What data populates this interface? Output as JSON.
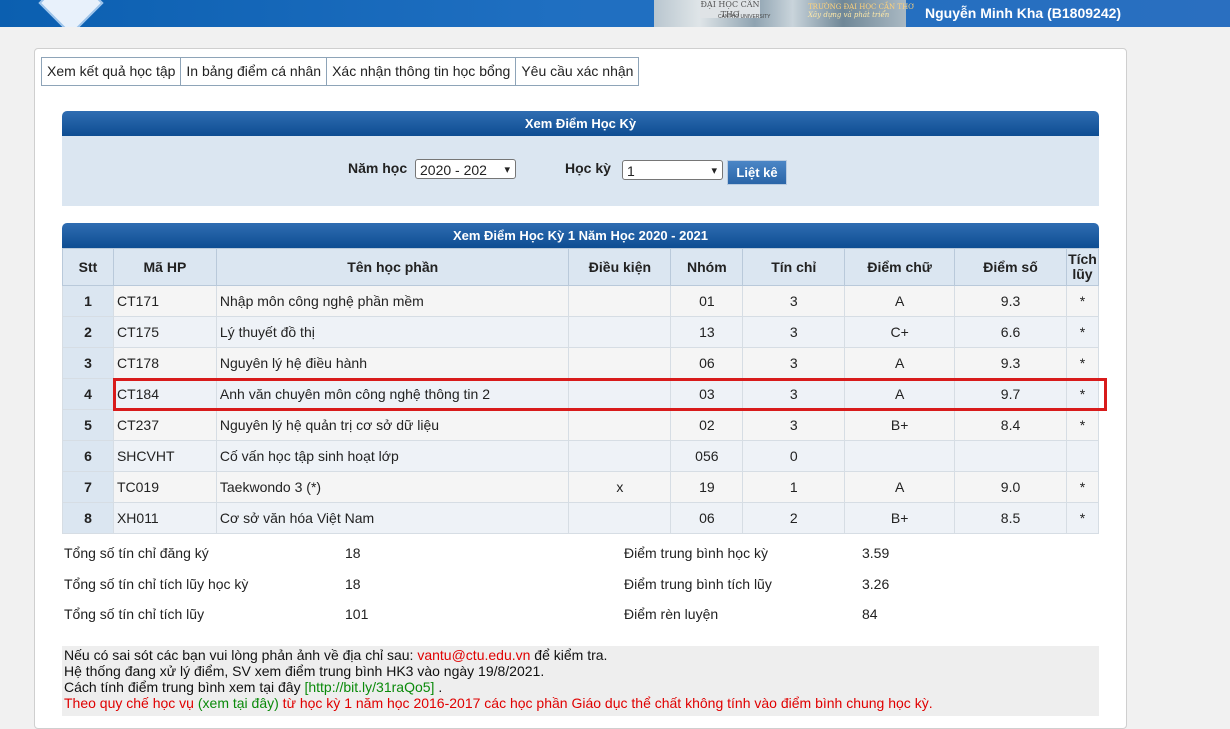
{
  "header": {
    "user_name": "Nguyễn Minh Kha (B1809242)",
    "campus_name": "ĐẠI HỌC CẦN THƠ",
    "campus_sub": "CANTHO UNIVERSITY",
    "school_name": "TRƯỜNG ĐẠI HỌC CẦN THƠ",
    "school_slogan": "Xây dựng và phát triển"
  },
  "tabs": [
    {
      "label": "Xem kết quả học tập"
    },
    {
      "label": "In bảng điểm cá nhân"
    },
    {
      "label": "Xác nhận thông tin học bổng"
    },
    {
      "label": "Yêu cầu xác nhận"
    }
  ],
  "filter": {
    "title": "Xem Điểm Học Kỳ",
    "year_label": "Năm học",
    "year_value": "2020 - 202",
    "semester_label": "Học kỳ",
    "semester_value": "1",
    "list_button": "Liệt kê"
  },
  "results": {
    "title": "Xem Điểm Học Kỳ 1 Năm Học 2020 - 2021",
    "headers": [
      "Stt",
      "Mã HP",
      "Tên học phần",
      "Điều kiện",
      "Nhóm",
      "Tín chỉ",
      "Điểm chữ",
      "Điểm số",
      "Tích lũy"
    ],
    "rows": [
      {
        "stt": "1",
        "code": "CT171",
        "name": "Nhập môn công nghệ phần mềm",
        "condition": "",
        "group": "01",
        "credits": "3",
        "letter": "A",
        "score": "9.3",
        "accum": "*"
      },
      {
        "stt": "2",
        "code": "CT175",
        "name": "Lý thuyết đồ thị",
        "condition": "",
        "group": "13",
        "credits": "3",
        "letter": "C+",
        "score": "6.6",
        "accum": "*"
      },
      {
        "stt": "3",
        "code": "CT178",
        "name": "Nguyên lý hệ điều hành",
        "condition": "",
        "group": "06",
        "credits": "3",
        "letter": "A",
        "score": "9.3",
        "accum": "*"
      },
      {
        "stt": "4",
        "code": "CT184",
        "name": "Anh văn chuyên môn công nghệ thông tin 2",
        "condition": "",
        "group": "03",
        "credits": "3",
        "letter": "A",
        "score": "9.7",
        "accum": "*"
      },
      {
        "stt": "5",
        "code": "CT237",
        "name": "Nguyên lý hệ quản trị cơ sở dữ liệu",
        "condition": "",
        "group": "02",
        "credits": "3",
        "letter": "B+",
        "score": "8.4",
        "accum": "*"
      },
      {
        "stt": "6",
        "code": "SHCVHT",
        "name": "Cố vấn học tập sinh hoạt lớp",
        "condition": "",
        "group": "056",
        "credits": "0",
        "letter": "",
        "score": "",
        "accum": ""
      },
      {
        "stt": "7",
        "code": "TC019",
        "name": "Taekwondo 3 (*)",
        "condition": "x",
        "group": "19",
        "credits": "1",
        "letter": "A",
        "score": "9.0",
        "accum": "*"
      },
      {
        "stt": "8",
        "code": "XH011",
        "name": "Cơ sở văn hóa Việt Nam",
        "condition": "",
        "group": "06",
        "credits": "2",
        "letter": "B+",
        "score": "8.5",
        "accum": "*"
      }
    ]
  },
  "summary": {
    "registered_label": "Tổng số tín chỉ đăng ký",
    "registered": "18",
    "accum_sem_label": "Tổng số tín chỉ tích lũy học kỳ",
    "accum_sem": "18",
    "accum_total_label": "Tổng số tín chỉ tích lũy",
    "accum_total": "101",
    "gpa_sem_label": "Điểm trung bình học kỳ",
    "gpa_sem": "3.59",
    "gpa_accum_label": "Điểm trung bình tích lũy",
    "gpa_accum": "3.26",
    "conduct_label": "Điểm rèn luyện",
    "conduct": "84"
  },
  "notes": {
    "line1_pre": "Nếu có sai sót các bạn vui lòng phản ảnh về địa chỉ sau: ",
    "line1_email": "vantu@ctu.edu.vn",
    "line1_post": " để kiểm tra.",
    "line2": "Hệ thống đang xử lý điểm, SV xem điểm trung bình HK3 vào ngày 19/8/2021.",
    "line3_pre": "Cách tính điểm trung bình xem tại đây ",
    "line3_link": "[http://bit.ly/31raQo5]",
    "line3_post": " .",
    "line4_pre": "Theo quy chế học vụ ",
    "line4_link": "(xem tại đây)",
    "line4_post": " từ học kỳ 1 năm học 2016-2017 các học phần Giáo dục thể chất không tính vào điểm bình chung học kỳ."
  }
}
